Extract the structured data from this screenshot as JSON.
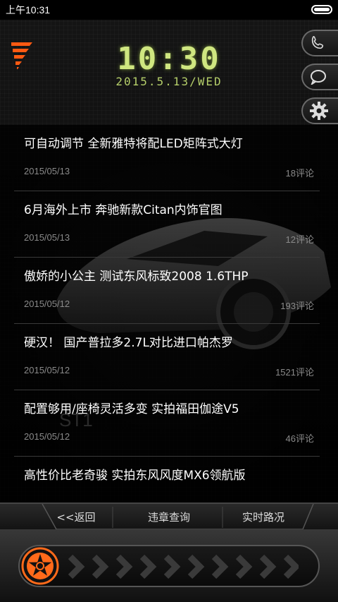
{
  "status_bar": {
    "time": "上午10:31"
  },
  "clock": {
    "time": "10:30",
    "date": "2015.5.13/WED"
  },
  "side_buttons": [
    "phone-icon",
    "message-icon",
    "gear-icon"
  ],
  "news": [
    {
      "title": "可自动调节 全新雅特将配LED矩阵式大灯",
      "date": "2015/05/13",
      "comments": "18评论"
    },
    {
      "title": "6月海外上市 奔驰新款Citan内饰官图",
      "date": "2015/05/13",
      "comments": "12评论"
    },
    {
      "title": "傲娇的小公主 测试东风标致2008 1.6THP",
      "date": "2015/05/12",
      "comments": "193评论"
    },
    {
      "title": "硬汉！ 国产普拉多2.7L对比进口帕杰罗",
      "date": "2015/05/12",
      "comments": "1521评论"
    },
    {
      "title": "配置够用/座椅灵活多变 实拍福田伽途V5",
      "date": "2015/05/12",
      "comments": "46评论"
    },
    {
      "title": "高性价比老奇骏 实拍东风风度MX6领航版",
      "date": "",
      "comments": ""
    }
  ],
  "nav": {
    "back": "<<返回",
    "violation": "违章查询",
    "traffic": "实时路况"
  },
  "colors": {
    "clock": "#cfe680",
    "accent": "#ff6a1a"
  }
}
